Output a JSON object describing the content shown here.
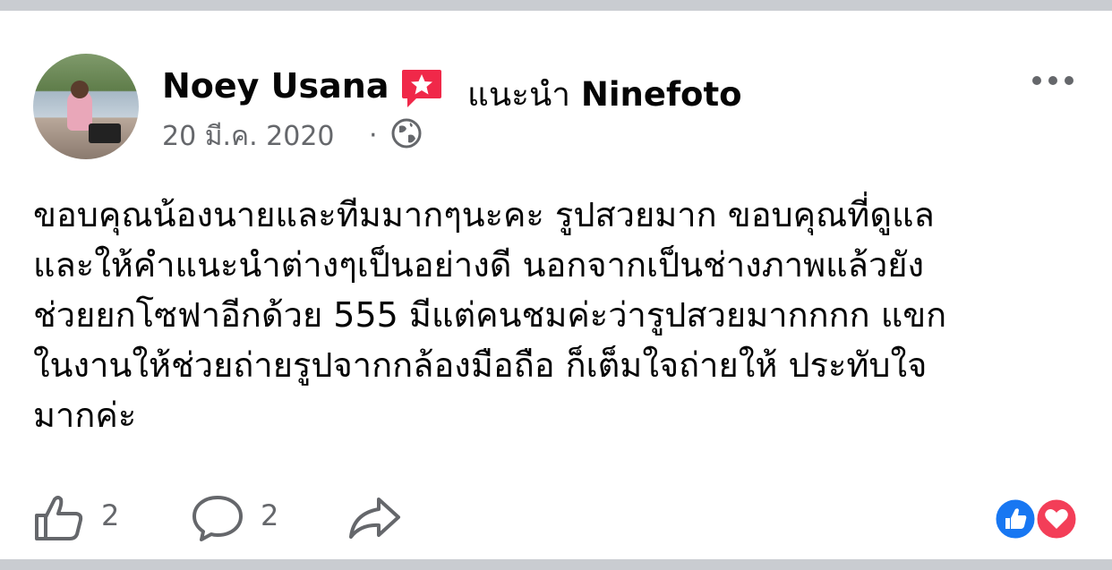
{
  "post": {
    "author": "Noey Usana",
    "recommend_prefix": "แนะนำ",
    "recommend_page": "Ninefoto",
    "date": "20 มี.ค. 2020",
    "separator": "·",
    "privacy_icon": "globe-icon",
    "body_lines": [
      "ขอบคุณน้องนายและทีมมากๆนะคะ รูปสวยมาก ขอบคุณที่ดูแล",
      "และให้คำแนะนำต่างๆเป็นอย่างดี นอกจากเป็นช่างภาพแล้วยัง",
      "ช่วยยกโซฟาอีกด้วย 555 มีแต่คนชมค่ะว่ารูปสวยมากกกก แขก",
      "ในงานให้ช่วยถ่ายรูปจากกล้องมือถือ ก็เต็มใจถ่ายให้ ประทับใจ",
      "มากค่ะ"
    ]
  },
  "actions": {
    "like_count": "2",
    "comment_count": "2",
    "like_icon": "thumbs-up-icon",
    "comment_icon": "comment-bubble-icon",
    "share_icon": "share-arrow-icon"
  },
  "colors": {
    "recommend": "#f02849",
    "like_blue": "#1877f2",
    "love_red": "#f33e58",
    "secondary_text": "#65676b"
  }
}
